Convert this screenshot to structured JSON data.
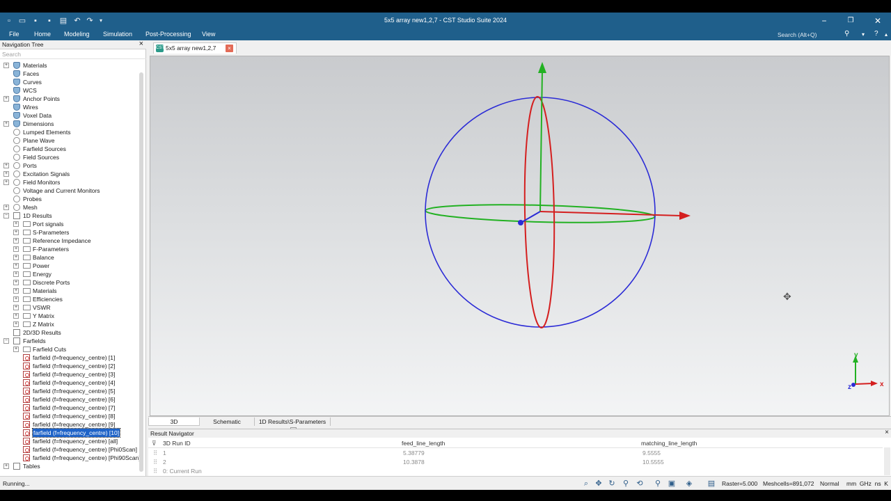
{
  "window": {
    "title": "5x5   array new1,2,7 - CST Studio Suite 2024",
    "controls": [
      "minimize",
      "restore",
      "close"
    ]
  },
  "quick_access": [
    "new-icon",
    "open-icon",
    "save-icon",
    "save-all-icon",
    "print-icon",
    "undo-icon",
    "redo-icon",
    "customize-icon"
  ],
  "menu": {
    "items": [
      "File",
      "Home",
      "Modeling",
      "Simulation",
      "Post-Processing",
      "View"
    ],
    "search_placeholder": "Search (Alt+Q)"
  },
  "nav": {
    "title": "Navigation Tree",
    "search_placeholder": "Search",
    "items": [
      {
        "label": "Materials",
        "expander": "+",
        "icon": "db",
        "level": 0
      },
      {
        "label": "Faces",
        "expander": "",
        "icon": "db",
        "level": 0
      },
      {
        "label": "Curves",
        "expander": "",
        "icon": "db",
        "level": 0
      },
      {
        "label": "WCS",
        "expander": "",
        "icon": "db",
        "level": 0
      },
      {
        "label": "Anchor Points",
        "expander": "+",
        "icon": "db",
        "level": 0
      },
      {
        "label": "Wires",
        "expander": "",
        "icon": "db",
        "level": 0
      },
      {
        "label": "Voxel Data",
        "expander": "",
        "icon": "db",
        "level": 0
      },
      {
        "label": "Dimensions",
        "expander": "+",
        "icon": "db",
        "level": 0
      },
      {
        "label": "Lumped Elements",
        "expander": "",
        "icon": "gear",
        "level": 0
      },
      {
        "label": "Plane Wave",
        "expander": "",
        "icon": "gear",
        "level": 0
      },
      {
        "label": "Farfield Sources",
        "expander": "",
        "icon": "gear",
        "level": 0
      },
      {
        "label": "Field Sources",
        "expander": "",
        "icon": "gear",
        "level": 0
      },
      {
        "label": "Ports",
        "expander": "+",
        "icon": "gear",
        "level": 0
      },
      {
        "label": "Excitation Signals",
        "expander": "+",
        "icon": "gear",
        "level": 0
      },
      {
        "label": "Field Monitors",
        "expander": "+",
        "icon": "gear",
        "level": 0
      },
      {
        "label": "Voltage and Current Monitors",
        "expander": "",
        "icon": "gear",
        "level": 0
      },
      {
        "label": "Probes",
        "expander": "",
        "icon": "gear",
        "level": 0
      },
      {
        "label": "Mesh",
        "expander": "+",
        "icon": "gear",
        "level": 0
      },
      {
        "label": "1D Results",
        "expander": "−",
        "icon": "res",
        "level": 0
      },
      {
        "label": "Port signals",
        "expander": "+",
        "icon": "folder",
        "level": 1
      },
      {
        "label": "S-Parameters",
        "expander": "+",
        "icon": "folder",
        "level": 1
      },
      {
        "label": "Reference Impedance",
        "expander": "+",
        "icon": "folder",
        "level": 1
      },
      {
        "label": "F-Parameters",
        "expander": "+",
        "icon": "folder",
        "level": 1
      },
      {
        "label": "Balance",
        "expander": "+",
        "icon": "folder",
        "level": 1
      },
      {
        "label": "Power",
        "expander": "+",
        "icon": "folder",
        "level": 1
      },
      {
        "label": "Energy",
        "expander": "+",
        "icon": "folder",
        "level": 1
      },
      {
        "label": "Discrete Ports",
        "expander": "+",
        "icon": "folder",
        "level": 1
      },
      {
        "label": "Materials",
        "expander": "+",
        "icon": "folder",
        "level": 1
      },
      {
        "label": "Efficiencies",
        "expander": "+",
        "icon": "folder",
        "level": 1
      },
      {
        "label": "VSWR",
        "expander": "+",
        "icon": "folder",
        "level": 1
      },
      {
        "label": "Y Matrix",
        "expander": "+",
        "icon": "folder",
        "level": 1
      },
      {
        "label": "Z Matrix",
        "expander": "+",
        "icon": "folder",
        "level": 1
      },
      {
        "label": "2D/3D Results",
        "expander": "",
        "icon": "res",
        "level": 0
      },
      {
        "label": "Farfields",
        "expander": "−",
        "icon": "res",
        "level": 0
      },
      {
        "label": "Farfield Cuts",
        "expander": "+",
        "icon": "folder",
        "level": 1
      },
      {
        "label": "farfield (f=frequency_centre) [1]",
        "expander": "",
        "icon": "far",
        "level": 1
      },
      {
        "label": "farfield (f=frequency_centre) [2]",
        "expander": "",
        "icon": "far",
        "level": 1
      },
      {
        "label": "farfield (f=frequency_centre) [3]",
        "expander": "",
        "icon": "far",
        "level": 1
      },
      {
        "label": "farfield (f=frequency_centre) [4]",
        "expander": "",
        "icon": "far",
        "level": 1
      },
      {
        "label": "farfield (f=frequency_centre) [5]",
        "expander": "",
        "icon": "far",
        "level": 1
      },
      {
        "label": "farfield (f=frequency_centre) [6]",
        "expander": "",
        "icon": "far",
        "level": 1
      },
      {
        "label": "farfield (f=frequency_centre) [7]",
        "expander": "",
        "icon": "far",
        "level": 1
      },
      {
        "label": "farfield (f=frequency_centre) [8]",
        "expander": "",
        "icon": "far",
        "level": 1
      },
      {
        "label": "farfield (f=frequency_centre) [9]",
        "expander": "",
        "icon": "far",
        "level": 1
      },
      {
        "label": "farfield (f=frequency_centre) [10]",
        "expander": "",
        "icon": "far",
        "level": 1,
        "selected": true
      },
      {
        "label": "farfield (f=frequency_centre) [all]",
        "expander": "",
        "icon": "far",
        "level": 1
      },
      {
        "label": "farfield (f=frequency_centre) [Phi0Scan]",
        "expander": "",
        "icon": "far",
        "level": 1
      },
      {
        "label": "farfield (f=frequency_centre) [Phi90Scan]",
        "expander": "",
        "icon": "far",
        "level": 1
      },
      {
        "label": "Tables",
        "expander": "+",
        "icon": "res",
        "level": 0
      }
    ]
  },
  "document_tab": {
    "label": "5x5   array new1,2,7",
    "icon_text": "CST"
  },
  "view": {
    "axes": {
      "x": "x",
      "y": "y",
      "z": "z"
    },
    "colors": {
      "sphere": "#2b2bd6",
      "x_axis": "#d41f1f",
      "y_axis": "#22b122",
      "z_axis": "#2b2bd6"
    }
  },
  "view_tabs": [
    {
      "label": "3D",
      "active": true
    },
    {
      "label": "Schematic",
      "active": false
    },
    {
      "label": "1D Results\\S-Parameters",
      "active": false,
      "closable": true
    }
  ],
  "result_navigator": {
    "title": "Result Navigator",
    "columns": [
      "3D Run ID",
      "feed_line_length",
      "matching_line_length"
    ],
    "rows": [
      {
        "id": "1",
        "feed_line_length": "5.38779",
        "matching_line_length": "9.5555"
      },
      {
        "id": "2",
        "feed_line_length": "10.3878",
        "matching_line_length": "10.5555"
      },
      {
        "id": "0: Current Run",
        "feed_line_length": "",
        "matching_line_length": ""
      }
    ]
  },
  "status": {
    "text": "Running...",
    "raster": "Raster=5.000",
    "meshcells": "Meshcells=891,072",
    "mode": "Normal",
    "units": "mm  GHz  ns  K"
  }
}
